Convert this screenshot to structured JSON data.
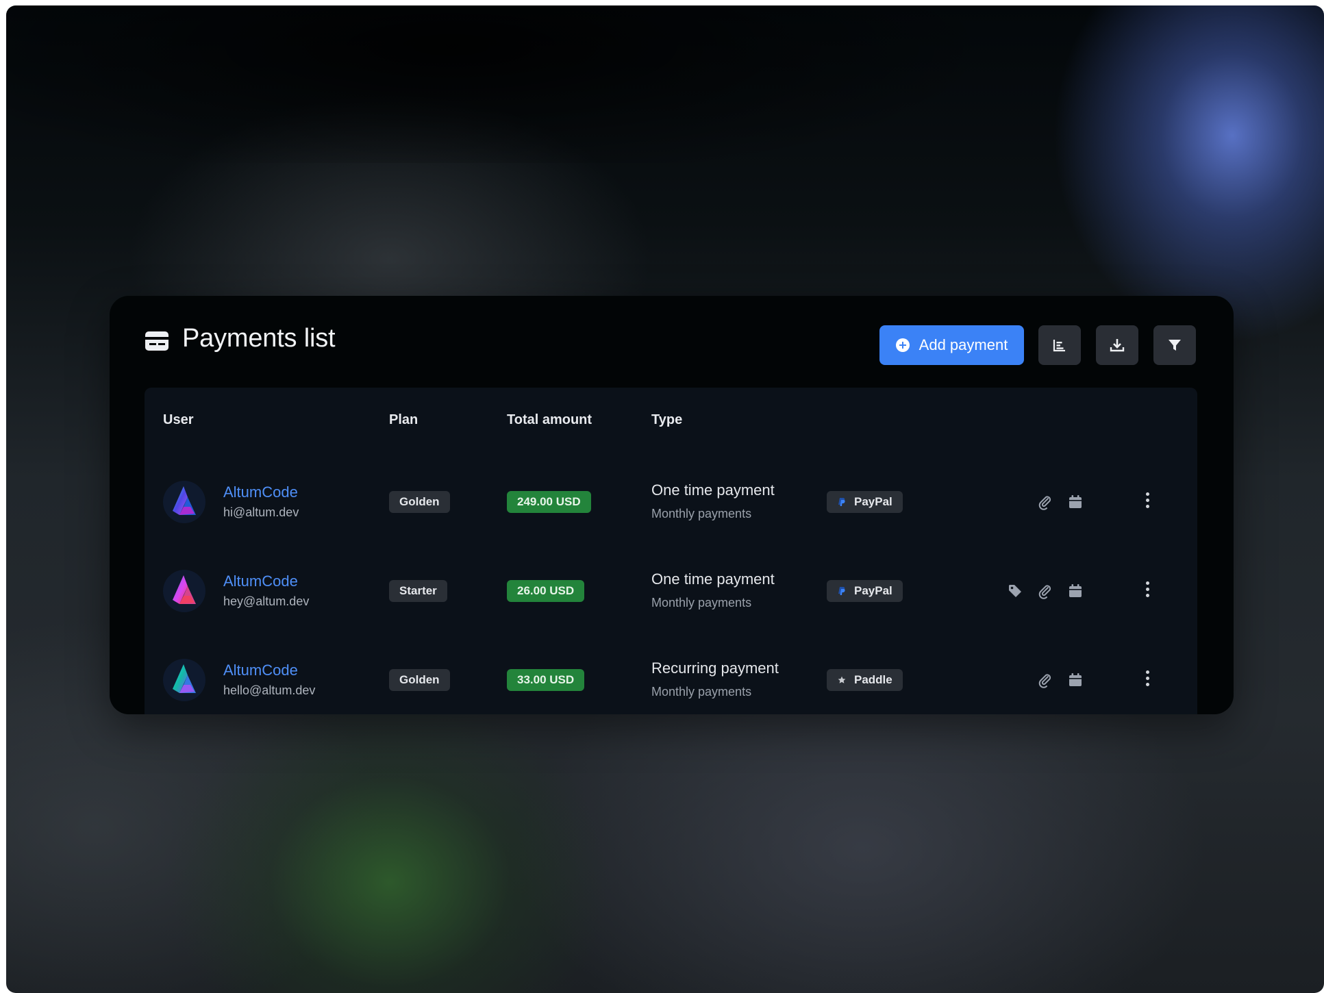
{
  "panel": {
    "title": "Payments list",
    "icon": "credit-card-icon",
    "toolbar": {
      "add_label": "Add payment",
      "buttons": [
        "chart-icon",
        "download-icon",
        "filter-icon"
      ]
    }
  },
  "table": {
    "headers": {
      "user": "User",
      "plan": "Plan",
      "amount": "Total amount",
      "type": "Type"
    },
    "rows": [
      {
        "name": "AltumCode",
        "email": "hi@altum.dev",
        "plan": "Golden",
        "amount": "249.00 USD",
        "type": "One time payment",
        "frequency": "Monthly payments",
        "processor": "PayPal",
        "processor_icon": "paypal-icon",
        "actions": [
          "paperclip-icon",
          "calendar-icon"
        ]
      },
      {
        "name": "AltumCode",
        "email": "hey@altum.dev",
        "plan": "Starter",
        "amount": "26.00 USD",
        "type": "One time payment",
        "frequency": "Monthly payments",
        "processor": "PayPal",
        "processor_icon": "paypal-icon",
        "actions": [
          "tag-icon",
          "paperclip-icon",
          "calendar-icon"
        ]
      },
      {
        "name": "AltumCode",
        "email": "hello@altum.dev",
        "plan": "Golden",
        "amount": "33.00 USD",
        "type": "Recurring payment",
        "frequency": "Monthly payments",
        "processor": "Paddle",
        "processor_icon": "star-icon",
        "actions": [
          "paperclip-icon",
          "calendar-icon"
        ]
      }
    ]
  },
  "colors": {
    "accent": "#3b82f6",
    "link": "#4f8ff7",
    "amount_badge": "#23843b",
    "panel_bg": "#020506",
    "table_bg": "#0b1119"
  }
}
